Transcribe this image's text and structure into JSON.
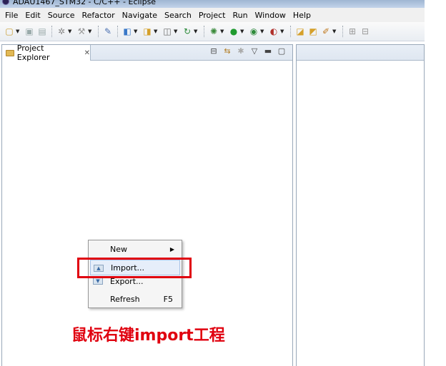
{
  "window": {
    "title": "ADAU1467_STM32 - C/C++ - Eclipse"
  },
  "menubar": {
    "items": [
      "File",
      "Edit",
      "Source",
      "Refactor",
      "Navigate",
      "Search",
      "Project",
      "Run",
      "Window",
      "Help"
    ]
  },
  "toolbar": {
    "icons": [
      "new-icon",
      "save-icon",
      "save-all-icon",
      "settings-icon",
      "build-icon",
      "debug-icon",
      "new-class-icon",
      "new-folder-icon",
      "new-file-icon",
      "refresh-icon",
      "bug-icon",
      "run-icon",
      "profile-icon",
      "external-tools-icon",
      "open-folder-icon",
      "open-project-icon",
      "tools-icon",
      "perspective-icon"
    ]
  },
  "project_explorer": {
    "tab_label": "Project Explorer",
    "tools": [
      "collapse-all-icon",
      "link-editor-icon",
      "filter-icon",
      "view-menu-icon",
      "minimize-icon",
      "maximize-icon"
    ]
  },
  "context_menu": {
    "items": [
      {
        "label": "New",
        "shortcut": "",
        "submenu": true
      },
      {
        "label": "Import...",
        "shortcut": "",
        "submenu": false
      },
      {
        "label": "Export...",
        "shortcut": "",
        "submenu": false
      },
      {
        "label": "Refresh",
        "shortcut": "F5",
        "submenu": false
      }
    ]
  },
  "annotation": {
    "text": "鼠标右键import工程"
  },
  "colors": {
    "highlight": "#e0000f",
    "panel_border": "#99a8b9",
    "menu_bg": "#f0f0f0"
  }
}
